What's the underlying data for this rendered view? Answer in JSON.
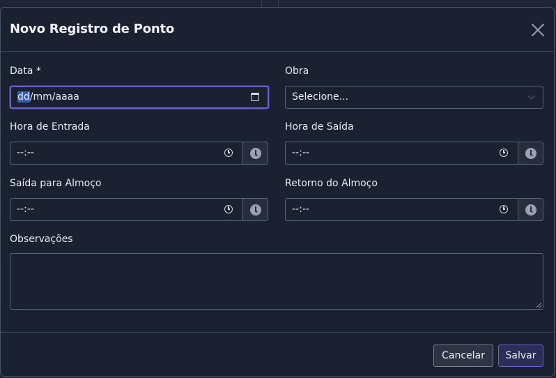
{
  "dialog": {
    "title": "Novo Registro de Ponto"
  },
  "fields": {
    "data": {
      "label": "Data *",
      "placeholder_selected": "dd",
      "placeholder_rest": "/mm/aaaa"
    },
    "obra": {
      "label": "Obra",
      "value": "Selecione..."
    },
    "hora_entrada": {
      "label": "Hora de Entrada",
      "value": "--:--"
    },
    "hora_saida": {
      "label": "Hora de Saída",
      "value": "--:--"
    },
    "saida_almoco": {
      "label": "Saída para Almoço",
      "value": "--:--"
    },
    "retorno_almoco": {
      "label": "Retorno do Almoço",
      "value": "--:--"
    },
    "observacoes": {
      "label": "Observações",
      "value": ""
    }
  },
  "footer": {
    "cancel_label": "Cancelar",
    "save_label": "Salvar"
  },
  "icons": {
    "close": "close-icon",
    "calendar": "calendar-icon",
    "chevron": "chevron-down-icon",
    "clock": "clock-icon"
  },
  "colors": {
    "accent": "#6c63c9",
    "background": "#1a2130",
    "border": "#5a6275"
  }
}
